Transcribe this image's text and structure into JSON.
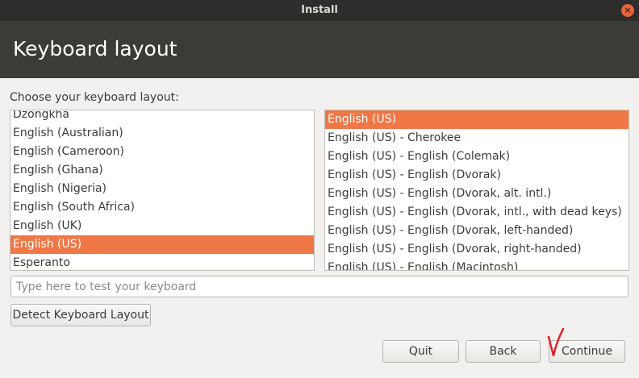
{
  "window": {
    "title": "Install",
    "close_symbol": "×"
  },
  "header": {
    "title": "Keyboard layout"
  },
  "prompt": "Choose your keyboard layout:",
  "layouts": [
    "Dzongkha",
    "English (Australian)",
    "English (Cameroon)",
    "English (Ghana)",
    "English (Nigeria)",
    "English (South Africa)",
    "English (UK)",
    "English (US)",
    "Esperanto"
  ],
  "selected_layout": "English (US)",
  "variants": [
    "English (US)",
    "English (US) - Cherokee",
    "English (US) - English (Colemak)",
    "English (US) - English (Dvorak)",
    "English (US) - English (Dvorak, alt. intl.)",
    "English (US) - English (Dvorak, intl., with dead keys)",
    "English (US) - English (Dvorak, left-handed)",
    "English (US) - English (Dvorak, right-handed)",
    "English (US) - English (Macintosh)"
  ],
  "selected_variant": "English (US)",
  "test_input": {
    "placeholder": "Type here to test your keyboard",
    "value": ""
  },
  "buttons": {
    "detect": "Detect Keyboard Layout",
    "quit": "Quit",
    "back": "Back",
    "continue": "Continue"
  },
  "colors": {
    "accent": "#f07746",
    "header_bg": "#3c3b37",
    "titlebar_bg": "#2f2d2b",
    "annotation": "#e0202a"
  }
}
